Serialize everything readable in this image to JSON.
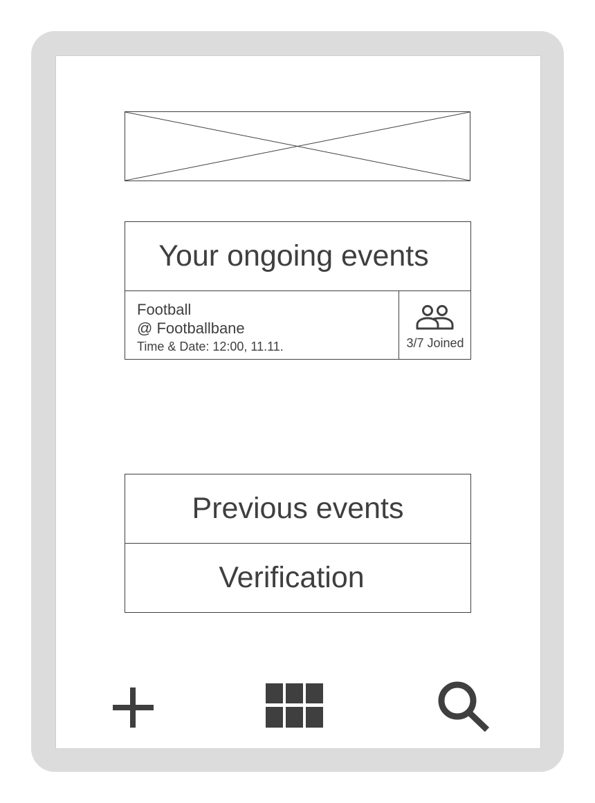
{
  "ongoing": {
    "title": "Your ongoing events",
    "event": {
      "name": "Football",
      "location": "@ Footballbane",
      "time": "Time & Date: 12:00, 11.11.",
      "joined": "3/7 Joined",
      "icon": "people-icon"
    }
  },
  "menu": {
    "previous_label": "Previous events",
    "verification_label": "Verification"
  },
  "bottom_nav": {
    "icons": [
      "plus-icon",
      "grid-icon",
      "search-icon"
    ]
  },
  "colors": {
    "device_frame": "#dcdcdc",
    "ink": "#3f3f3f",
    "screen": "#ffffff"
  }
}
